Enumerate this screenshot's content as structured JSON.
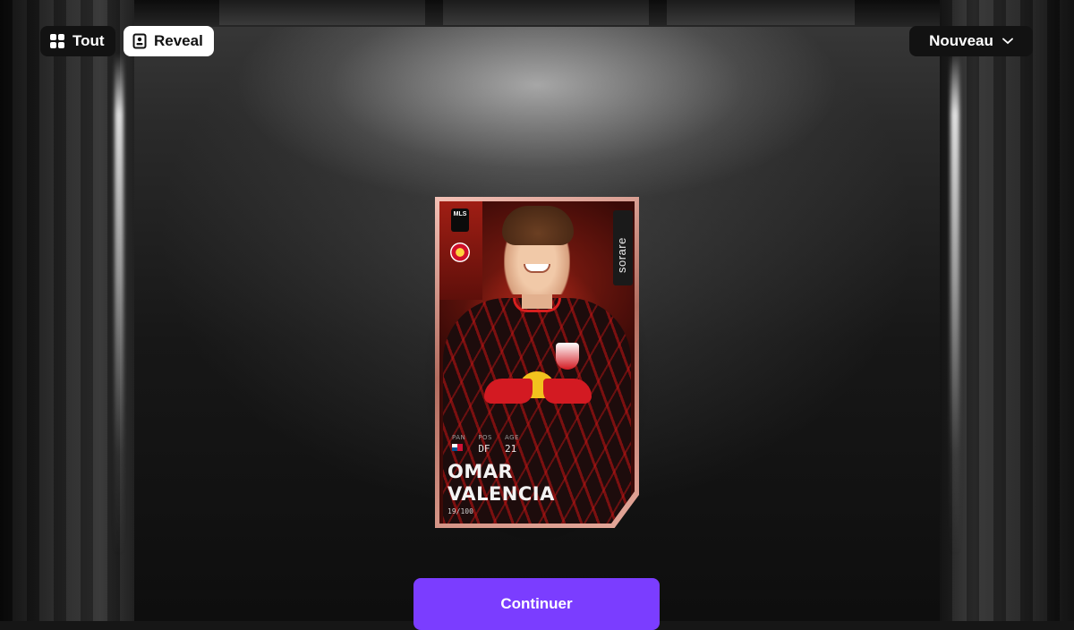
{
  "toolbar": {
    "tout_label": "Tout",
    "reveal_label": "Reveal",
    "sort_label": "Nouveau"
  },
  "icons": {
    "tout": "grid-icon",
    "reveal": "card-icon",
    "sort": "chevron-down-icon"
  },
  "card": {
    "brand": "sorare",
    "league_badge": "MLS",
    "stats": [
      {
        "label": "PAN",
        "value": ""
      },
      {
        "label": "POS",
        "value": "DF"
      },
      {
        "label": "AGE",
        "value": "21"
      }
    ],
    "first_name": "OMAR",
    "last_name": "VALENCIA",
    "serial": "19/100"
  },
  "actions": {
    "continue_label": "Continuer"
  },
  "colors": {
    "primary": "#7b3dff",
    "button_dark": "#121212",
    "button_light": "#ffffff"
  }
}
